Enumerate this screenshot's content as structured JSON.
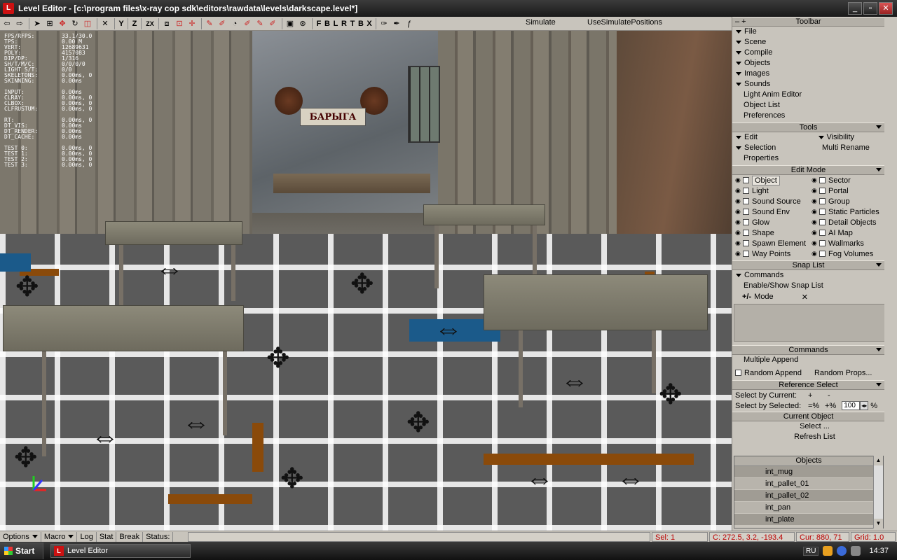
{
  "window": {
    "app_icon": "L",
    "title": "Level Editor - [c:\\program files\\x-ray cop sdk\\editors\\rawdata\\levels\\darkscape.level*]",
    "btn_min": "_",
    "btn_max": "▫",
    "btn_close": "✕"
  },
  "toolbar": {
    "axis_y": "Y",
    "axis_z": "Z",
    "axis_zx": "ZX",
    "letters": [
      "F",
      "B",
      "L",
      "R",
      "T",
      "B",
      "X"
    ],
    "simulate": "Simulate",
    "use_simulate_positions": "UseSimulatePositions"
  },
  "viewport": {
    "sign_text": "БАРЫГА",
    "stats": [
      {
        "k": "FPS/RFPS:",
        "v": "33.1/30.0"
      },
      {
        "k": "TPS:",
        "v": "0.00 M"
      },
      {
        "k": "VERT:",
        "v": "12689631"
      },
      {
        "k": "POLY:",
        "v": "4157083"
      },
      {
        "k": "DIP/DP:",
        "v": "1/316"
      },
      {
        "k": "SH/T/M/C:",
        "v": "0/0/0/0"
      },
      {
        "k": "LIGHT S/T:",
        "v": "0/0"
      },
      {
        "k": "SKELETONS:",
        "v": "0.00ms, 0"
      },
      {
        "k": "SKINNING:",
        "v": "0.00ms"
      }
    ],
    "stats2": [
      {
        "k": "INPUT:",
        "v": "0.00ms"
      },
      {
        "k": "CLRAY:",
        "v": "0.00ms, 0"
      },
      {
        "k": "CLBOX:",
        "v": "0.00ms, 0"
      },
      {
        "k": "CLFRUSTUM:",
        "v": "0.00ms, 0"
      }
    ],
    "stats3": [
      {
        "k": " RT:",
        "v": "0.00ms, 0"
      },
      {
        "k": " DT_VIS:",
        "v": "0.00ms"
      },
      {
        "k": " DT_RENDER:",
        "v": "0.00ms"
      },
      {
        "k": " DT_CACHE:",
        "v": "0.00ms"
      }
    ],
    "stats4": [
      {
        "k": "TEST 0:",
        "v": "0.00ms, 0"
      },
      {
        "k": "TEST 1:",
        "v": "0.00ms, 0"
      },
      {
        "k": "TEST 2:",
        "v": "0.00ms, 0"
      },
      {
        "k": "TEST 3:",
        "v": "0.00ms, 0"
      }
    ]
  },
  "panel": {
    "toolbar_header": "Toolbar",
    "toolbar_menu": [
      "File",
      "Scene",
      "Compile",
      "Objects",
      "Images",
      "Sounds"
    ],
    "toolbar_plain": [
      "Light Anim Editor",
      "Object List",
      "Preferences"
    ],
    "tools_header": "Tools",
    "tools": {
      "edit": "Edit",
      "visibility": "Visibility",
      "selection": "Selection",
      "multi_rename": "Multi Rename",
      "properties": "Properties"
    },
    "edit_mode_header": "Edit Mode",
    "edit_mode_left": [
      "Object",
      "Light",
      "Sound Source",
      "Sound Env",
      "Glow",
      "Shape",
      "Spawn Element",
      "Way Points"
    ],
    "edit_mode_right": [
      "Sector",
      "Portal",
      "Group",
      "Static Particles",
      "Detail Objects",
      "AI Map",
      "Wallmarks",
      "Fog Volumes"
    ],
    "snap_header": "Snap List",
    "snap_commands": "Commands",
    "snap_enable": "Enable/Show Snap List",
    "snap_mode_icon": "+/-",
    "snap_mode": "Mode",
    "snap_x": "✕",
    "commands_header": "Commands",
    "multiple_append": "Multiple Append",
    "random_append": "Random Append",
    "random_props": "Random Props...",
    "ref_header": "Reference Select",
    "select_by_current": "Select by Current:",
    "cur_plus": "+",
    "cur_minus": "-",
    "select_by_selected": "Select by Selected:",
    "sel_eq": "=%",
    "sel_plus": "+%",
    "sel_value": "100",
    "sel_pct": "%",
    "current_object_header": "Current Object",
    "select_btn": "Select ...",
    "refresh_list": "Refresh List",
    "objects_header": "Objects",
    "objects": [
      "int_mug",
      "int_pallet_01",
      "int_pallet_02",
      "int_pan",
      "int_plate"
    ]
  },
  "statusbar": {
    "options": "Options",
    "macro": "Macro",
    "log": "Log",
    "stat": "Stat",
    "break": "Break",
    "status": "Status:",
    "sel": "Sel: 1",
    "coords": "C: 272.5, 3.2, -193.4",
    "cur": "Cur: 880, 71",
    "grid": "Grid: 1.0"
  },
  "taskbar": {
    "start": "Start",
    "task_icon": "L",
    "task_label": "Level Editor",
    "lang": "RU",
    "clock": "14:37"
  },
  "colors": {
    "panel_bg": "#c8c4bc",
    "status_red": "#bb0000",
    "stripe_brown": "#8a4a0a",
    "tile_blue": "#1b5a8a"
  }
}
